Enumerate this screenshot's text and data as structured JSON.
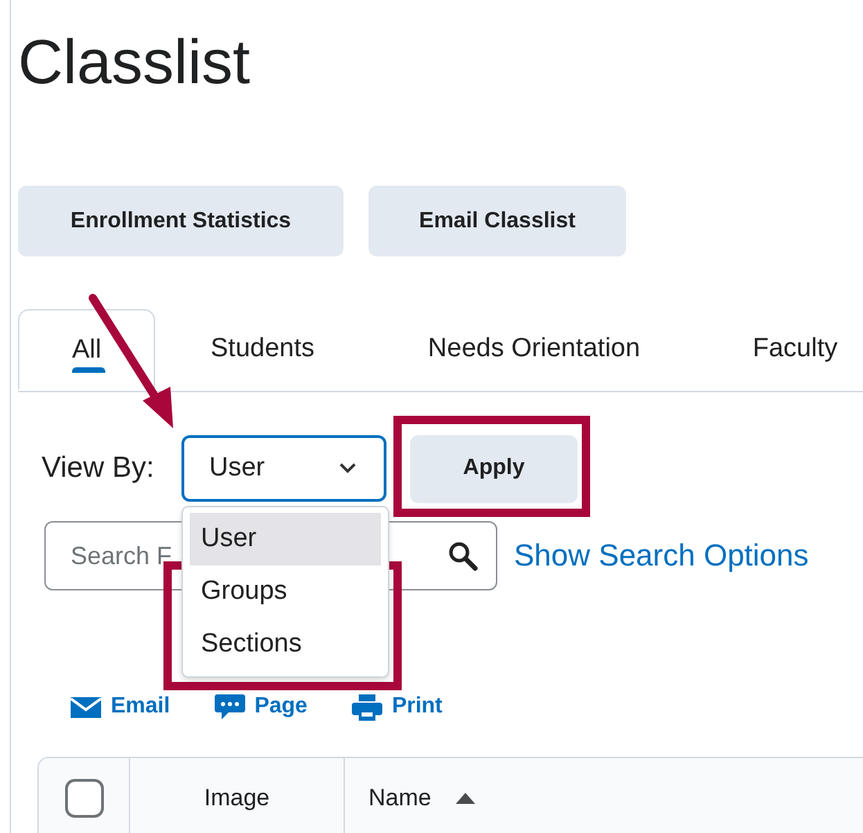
{
  "page_title": "Classlist",
  "buttons": [
    "Enrollment Statistics",
    "Email Classlist"
  ],
  "tabs": [
    {
      "label": "All",
      "selected": true
    },
    {
      "label": "Students",
      "selected": false
    },
    {
      "label": "Needs Orientation",
      "selected": false
    },
    {
      "label": "Faculty",
      "selected": false
    }
  ],
  "view_by": {
    "label": "View By:",
    "value": "User",
    "apply": "Apply",
    "expanded": true,
    "options": [
      {
        "label": "User",
        "selected": true
      },
      {
        "label": "Groups",
        "selected": false
      },
      {
        "label": "Sections",
        "selected": false
      }
    ]
  },
  "search": {
    "placeholder": "Search F",
    "options_link": "Show Search Options"
  },
  "actions": [
    {
      "kind": "email",
      "label": "Email"
    },
    {
      "kind": "page",
      "label": "Page"
    },
    {
      "kind": "print",
      "label": "Print"
    }
  ],
  "table": {
    "select_all_checked": false,
    "columns": [
      {
        "label": "Image",
        "sorted": false
      },
      {
        "label": "Name",
        "sorted": true
      }
    ]
  }
}
